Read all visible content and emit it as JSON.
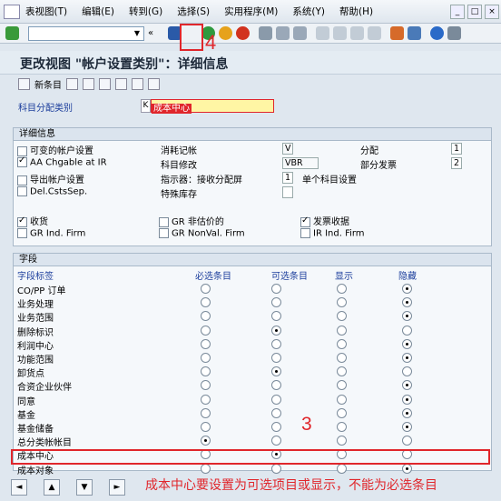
{
  "menu": [
    "表视图(T)",
    "编辑(E)",
    "转到(G)",
    "选择(S)",
    "实用程序(M)",
    "系统(Y)",
    "帮助(H)"
  ],
  "annotations": {
    "step4": "4",
    "step3": "3",
    "note": "成本中心要设置为可选项目或显示，不能为必选条目"
  },
  "title": "更改视图 \"帐户设置类别\"：详细信息",
  "app_toolbar": {
    "new_entries": "新条目"
  },
  "assignment": {
    "label": "科目分配类别",
    "code": "K",
    "value": "成本中心"
  },
  "detail": {
    "heading": "详细信息",
    "variable_acct": "可变的帐户设置",
    "aa_chgable": "AA Chgable at IR",
    "derive_acct": "导出帐户设置",
    "del_csts": "Del.CstsSep.",
    "consumption_label": "消耗记帐",
    "consumption_value": "V",
    "acct_mod_label": "科目修改",
    "acct_mod_value": "VBR",
    "indicator_label": "指示器：接收分配屏",
    "indicator_value": "1",
    "special_stock": "特殊库存",
    "distribution_label": "分配",
    "distribution_value": "1",
    "partial_invoice_label": "部分发票",
    "partial_invoice_value": "2",
    "single_acct": "单个科目设置",
    "goods_receipt": "收货",
    "gr_non_valuated": "GR 非估价的",
    "invoice_receipt": "发票收据",
    "gr_ind_firm": "GR Ind. Firm",
    "gr_nonval_firm": "GR NonVal. Firm",
    "ir_ind_firm": "IR Ind. Firm"
  },
  "fields": {
    "heading": "字段",
    "columns": [
      "字段标签",
      "必选条目",
      "可选条目",
      "显示",
      "隐藏"
    ],
    "rows": [
      {
        "label": "CO/PP 订单",
        "selected": 3
      },
      {
        "label": "业务处理",
        "selected": 3
      },
      {
        "label": "业务范围",
        "selected": 3
      },
      {
        "label": "删除标识",
        "selected": 1
      },
      {
        "label": "利润中心",
        "selected": 3
      },
      {
        "label": "功能范围",
        "selected": 3
      },
      {
        "label": "卸货点",
        "selected": 1
      },
      {
        "label": "合资企业伙伴",
        "selected": 3
      },
      {
        "label": "同意",
        "selected": 3
      },
      {
        "label": "基金",
        "selected": 3
      },
      {
        "label": "基金储备",
        "selected": 3
      },
      {
        "label": "总分类帐帐目",
        "selected": 0
      },
      {
        "label": "成本中心",
        "selected": 1
      },
      {
        "label": "成本对象",
        "selected": 3
      }
    ]
  }
}
